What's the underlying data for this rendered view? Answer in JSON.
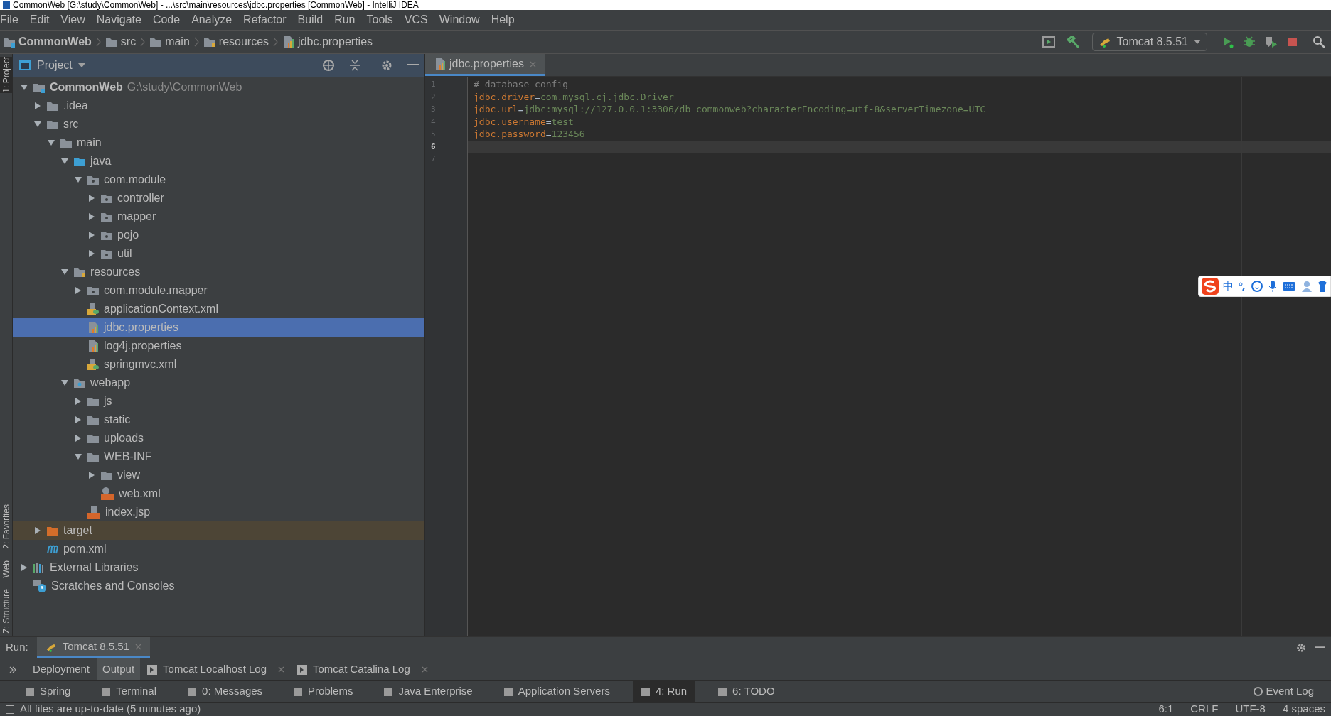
{
  "window": {
    "title": "CommonWeb [G:\\study\\CommonWeb] - ...\\src\\main\\resources\\jdbc.properties [CommonWeb] - IntelliJ IDEA"
  },
  "menu": [
    "File",
    "Edit",
    "View",
    "Navigate",
    "Code",
    "Analyze",
    "Refactor",
    "Build",
    "Run",
    "Tools",
    "VCS",
    "Window",
    "Help"
  ],
  "breadcrumbs": [
    {
      "label": "CommonWeb",
      "kind": "module"
    },
    {
      "label": "src",
      "kind": "folder"
    },
    {
      "label": "main",
      "kind": "folder"
    },
    {
      "label": "resources",
      "kind": "resources"
    },
    {
      "label": "jdbc.properties",
      "kind": "properties"
    }
  ],
  "run_config": {
    "label": "Tomcat 8.5.51"
  },
  "left_stripe": [
    {
      "label": "1: Project",
      "selected": true
    },
    {
      "label": "2: Favorites",
      "selected": false
    },
    {
      "label": "Web",
      "selected": false
    },
    {
      "label": "Z: Structure",
      "selected": false
    }
  ],
  "project_panel": {
    "title": "Project"
  },
  "tree": [
    {
      "label": "CommonWeb",
      "path": "G:\\study\\CommonWeb",
      "kind": "module",
      "expanded": true,
      "selected": false,
      "children": [
        {
          "label": ".idea",
          "kind": "folder",
          "expanded": false,
          "selected": false
        },
        {
          "label": "src",
          "kind": "folder",
          "expanded": true,
          "selected": false,
          "children": [
            {
              "label": "main",
              "kind": "folder",
              "expanded": true,
              "selected": false,
              "children": [
                {
                  "label": "java",
                  "kind": "source",
                  "expanded": true,
                  "selected": false,
                  "children": [
                    {
                      "label": "com.module",
                      "kind": "package",
                      "expanded": true,
                      "selected": false,
                      "children": [
                        {
                          "label": "controller",
                          "kind": "package",
                          "expanded": false,
                          "selected": false
                        },
                        {
                          "label": "mapper",
                          "kind": "package",
                          "expanded": false,
                          "selected": false
                        },
                        {
                          "label": "pojo",
                          "kind": "package",
                          "expanded": false,
                          "selected": false
                        },
                        {
                          "label": "util",
                          "kind": "package",
                          "expanded": false,
                          "selected": false
                        }
                      ]
                    }
                  ]
                },
                {
                  "label": "resources",
                  "kind": "resources",
                  "expanded": true,
                  "selected": false,
                  "children": [
                    {
                      "label": "com.module.mapper",
                      "kind": "package",
                      "expanded": false,
                      "selected": false
                    },
                    {
                      "label": "applicationContext.xml",
                      "kind": "spring",
                      "selected": false
                    },
                    {
                      "label": "jdbc.properties",
                      "kind": "properties",
                      "selected": true
                    },
                    {
                      "label": "log4j.properties",
                      "kind": "properties",
                      "selected": false
                    },
                    {
                      "label": "springmvc.xml",
                      "kind": "spring",
                      "selected": false
                    }
                  ]
                },
                {
                  "label": "webapp",
                  "kind": "web",
                  "expanded": true,
                  "selected": false,
                  "children": [
                    {
                      "label": "js",
                      "kind": "folder",
                      "expanded": false,
                      "selected": false
                    },
                    {
                      "label": "static",
                      "kind": "folder",
                      "expanded": false,
                      "selected": false
                    },
                    {
                      "label": "uploads",
                      "kind": "folder",
                      "expanded": false,
                      "selected": false
                    },
                    {
                      "label": "WEB-INF",
                      "kind": "folder",
                      "expanded": true,
                      "selected": false,
                      "children": [
                        {
                          "label": "view",
                          "kind": "folder",
                          "expanded": false,
                          "selected": false
                        },
                        {
                          "label": "web.xml",
                          "kind": "webxml",
                          "selected": false
                        }
                      ]
                    },
                    {
                      "label": "index.jsp",
                      "kind": "jsp",
                      "selected": false
                    }
                  ]
                }
              ]
            }
          ]
        },
        {
          "label": "target",
          "kind": "excluded",
          "expanded": false,
          "selected": false
        },
        {
          "label": "pom.xml",
          "kind": "maven",
          "selected": false
        }
      ]
    },
    {
      "label": "External Libraries",
      "kind": "libraries",
      "expanded": false,
      "selected": false
    },
    {
      "label": "Scratches and Consoles",
      "kind": "scratches",
      "selected": false
    }
  ],
  "editor_tabs": [
    {
      "label": "jdbc.properties",
      "selected": true
    }
  ],
  "code": [
    {
      "number": "1",
      "kind": "comment",
      "text": "# database config"
    },
    {
      "number": "2",
      "kind": "pair",
      "key": "jdbc.driver",
      "separator": "=",
      "value": "com.mysql.cj.jdbc.Driver"
    },
    {
      "number": "3",
      "kind": "pair",
      "key": "jdbc.url",
      "separator": "=",
      "value": "jdbc:mysql://127.0.0.1:3306/db_commonweb?characterEncoding=utf-8&serverTimezone=UTC"
    },
    {
      "number": "4",
      "kind": "pair",
      "key": "jdbc.username",
      "separator": "=",
      "value": "test"
    },
    {
      "number": "5",
      "kind": "pair",
      "key": "jdbc.password",
      "separator": "=",
      "value": "123456"
    },
    {
      "number": "6",
      "kind": "blank",
      "current": true
    },
    {
      "number": "7",
      "kind": "blank",
      "current": false
    }
  ],
  "ime_toolbar": {
    "mode": "中"
  },
  "run_panel": {
    "label": "Run:",
    "tab": "Tomcat 8.5.51",
    "subtabs": [
      {
        "label": "Deployment",
        "selected": false
      },
      {
        "label": "Output",
        "selected": true
      },
      {
        "label": "Tomcat Localhost Log",
        "selected": false,
        "closable": true
      },
      {
        "label": "Tomcat Catalina Log",
        "selected": false,
        "closable": true
      }
    ]
  },
  "tool_windows": [
    {
      "label": "Spring",
      "selected": false
    },
    {
      "label": "Terminal",
      "selected": false
    },
    {
      "label": "0: Messages",
      "selected": false
    },
    {
      "label": "Problems",
      "selected": false
    },
    {
      "label": "Java Enterprise",
      "selected": false
    },
    {
      "label": "Application Servers",
      "selected": false
    },
    {
      "label": "4: Run",
      "selected": true
    },
    {
      "label": "6: TODO",
      "selected": false
    }
  ],
  "event_log": "Event Log",
  "status_bar": {
    "message": "All files are up-to-date (5 minutes ago)",
    "position": "6:1",
    "line_separator": "CRLF",
    "encoding": "UTF-8",
    "indent": "4 spaces"
  }
}
